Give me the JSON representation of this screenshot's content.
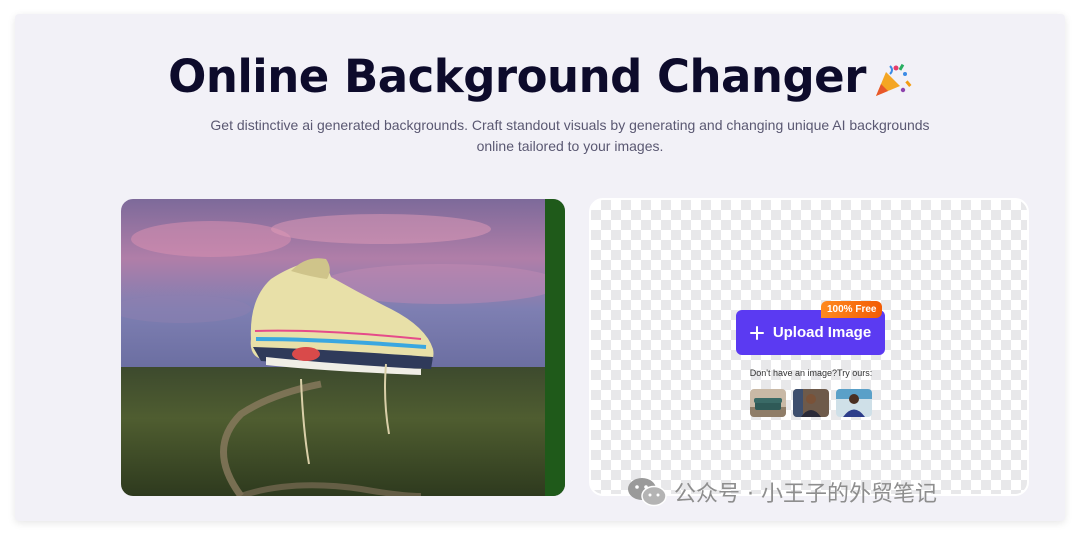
{
  "hero": {
    "title": "Online Background Changer",
    "title_emoji": "party-popper-icon",
    "subtitle": "Get distinctive ai generated backgrounds. Craft standout visuals by generating and changing unique AI backgrounds online tailored to your images."
  },
  "example": {
    "subject": "sneaker floating over a grassy field at dusk"
  },
  "upload": {
    "button_label": "Upload Image",
    "badge": "100% Free",
    "try_text": "Don't have an image?Try ours:",
    "samples": [
      "sofa",
      "man portrait",
      "woman portrait"
    ]
  },
  "watermark": {
    "text": "公众号 · 小王子的外贸笔记",
    "icon": "wechat-icon"
  },
  "colors": {
    "primary": "#5b3af2",
    "badge": "#f25c05",
    "title": "#0d0b2b"
  }
}
